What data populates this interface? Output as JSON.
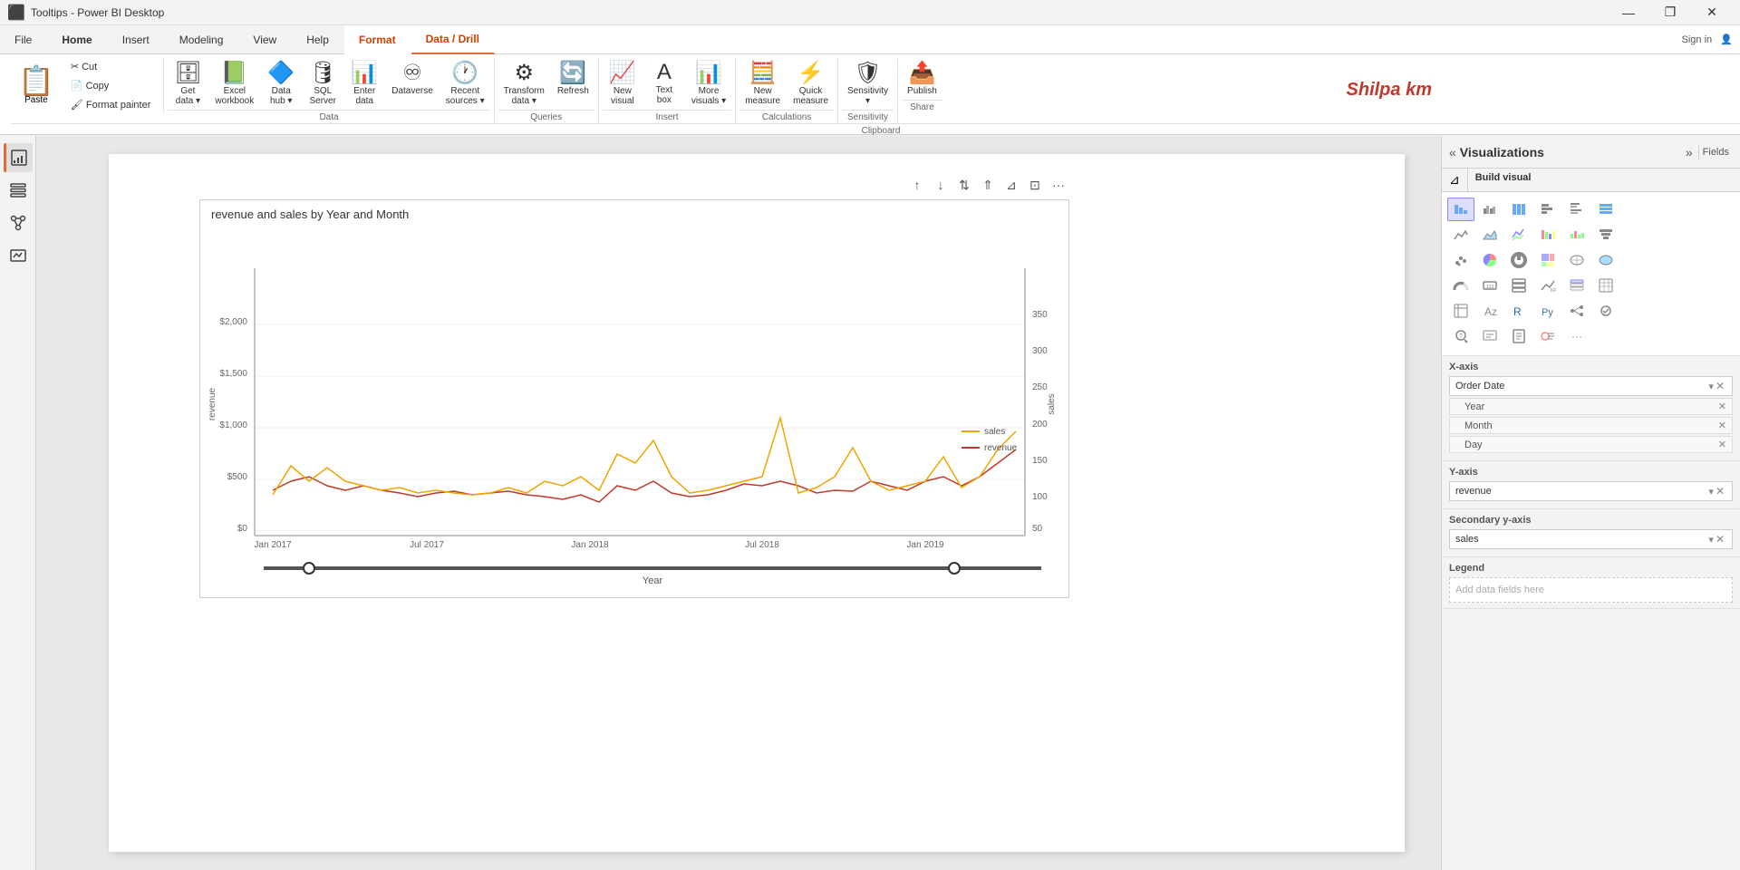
{
  "titlebar": {
    "title": "Tooltips - Power BI Desktop",
    "controls": [
      "—",
      "❐",
      "✕"
    ]
  },
  "ribbon": {
    "tabs": [
      {
        "label": "File",
        "active": false
      },
      {
        "label": "Home",
        "active": false,
        "bold": true
      },
      {
        "label": "Insert",
        "active": false
      },
      {
        "label": "Modeling",
        "active": false
      },
      {
        "label": "View",
        "active": false
      },
      {
        "label": "Help",
        "active": false
      },
      {
        "label": "Format",
        "active": false,
        "highlighted": true
      },
      {
        "label": "Data / Drill",
        "active": true,
        "highlighted": true
      }
    ],
    "groups": {
      "clipboard": {
        "label": "Clipboard",
        "items": [
          "Paste",
          "Cut",
          "Copy",
          "Format painter"
        ]
      },
      "data": {
        "label": "Data",
        "items": [
          "Get data",
          "Excel workbook",
          "Data hub",
          "SQL Server",
          "Enter data",
          "Dataverse",
          "Recent sources"
        ]
      },
      "queries": {
        "label": "Queries",
        "items": [
          "Transform data",
          "Refresh"
        ]
      },
      "insert": {
        "label": "Insert",
        "items": [
          "New visual",
          "Text box",
          "More visuals"
        ]
      },
      "calculations": {
        "label": "Calculations",
        "items": [
          "New measure",
          "Quick measure"
        ]
      },
      "sensitivity": {
        "label": "Sensitivity",
        "items": [
          "Sensitivity"
        ]
      },
      "share": {
        "label": "Share",
        "items": [
          "Publish"
        ]
      }
    }
  },
  "user": {
    "name": "Shilpa km"
  },
  "chart": {
    "title": "revenue and sales by Year and Month",
    "xLabels": [
      "Jan 2017",
      "Jul 2017",
      "Jan 2018",
      "Jul 2018",
      "Jan 2019"
    ],
    "yLeftLabels": [
      "$0",
      "$500",
      "$1,000",
      "$1,500",
      "$2,000"
    ],
    "yRightLabels": [
      "50",
      "100",
      "150",
      "200",
      "250",
      "300",
      "350"
    ],
    "yLeftAxis": "revenue",
    "yRightAxis": "sales",
    "sliderLabel": "Year",
    "legend": {
      "sales": "sales",
      "revenue": "revenue"
    }
  },
  "visualizations": {
    "title": "Visualizations",
    "tabs": [
      "Build visual",
      "Filters"
    ],
    "xAxis": {
      "label": "X-axis",
      "field": "Order Date",
      "subfields": [
        "Year",
        "Month",
        "Day"
      ]
    },
    "yAxis": {
      "label": "Y-axis",
      "field": "revenue"
    },
    "secondaryYAxis": {
      "label": "Secondary y-axis",
      "field": "sales"
    },
    "legend": {
      "label": "Legend"
    }
  },
  "icons": {
    "bar_chart": "▊",
    "line_chart": "📈",
    "area_chart": "◬",
    "scatter": "⬡",
    "pie": "◑",
    "donut": "○",
    "table": "⊞",
    "matrix": "⊟",
    "card": "▣"
  }
}
